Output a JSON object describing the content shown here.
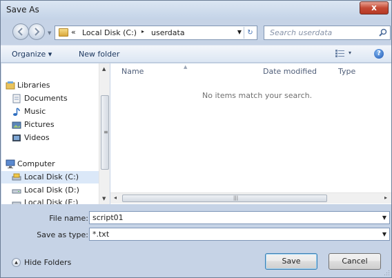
{
  "window": {
    "title": "Save As",
    "close_label": "x"
  },
  "address": {
    "chevron": "«",
    "segments": [
      "Local Disk (C:)",
      "userdata"
    ],
    "separator": "▸"
  },
  "search": {
    "placeholder": "Search userdata"
  },
  "toolbar": {
    "organize": "Organize ▾",
    "new_folder": "New folder",
    "views_dropdown": "▾",
    "help": "?"
  },
  "nav": {
    "items": [
      {
        "label": "Libraries",
        "icon": "libraries-icon"
      },
      {
        "label": "Documents",
        "icon": "documents-icon"
      },
      {
        "label": "Music",
        "icon": "music-icon"
      },
      {
        "label": "Pictures",
        "icon": "pictures-icon"
      },
      {
        "label": "Videos",
        "icon": "videos-icon"
      },
      {
        "label": "Computer",
        "icon": "computer-icon"
      },
      {
        "label": "Local Disk (C:)",
        "icon": "drive-icon",
        "selected": true
      },
      {
        "label": "Local Disk (D:)",
        "icon": "drive-icon"
      },
      {
        "label": "Local Disk (E:)",
        "icon": "drive-icon"
      }
    ]
  },
  "filelist": {
    "columns": [
      "Name",
      "Date modified",
      "Type"
    ],
    "empty_message": "No items match your search."
  },
  "form": {
    "filename_label": "File name:",
    "filename_value": "script01",
    "savetype_label": "Save as type:",
    "savetype_value": "*.txt"
  },
  "buttons": {
    "hide_folders": "Hide Folders",
    "save": "Save",
    "cancel": "Cancel"
  },
  "colors": {
    "selection": "#dbe8f8",
    "chrome": "#c6d3e6",
    "link_text": "#1e3960"
  }
}
